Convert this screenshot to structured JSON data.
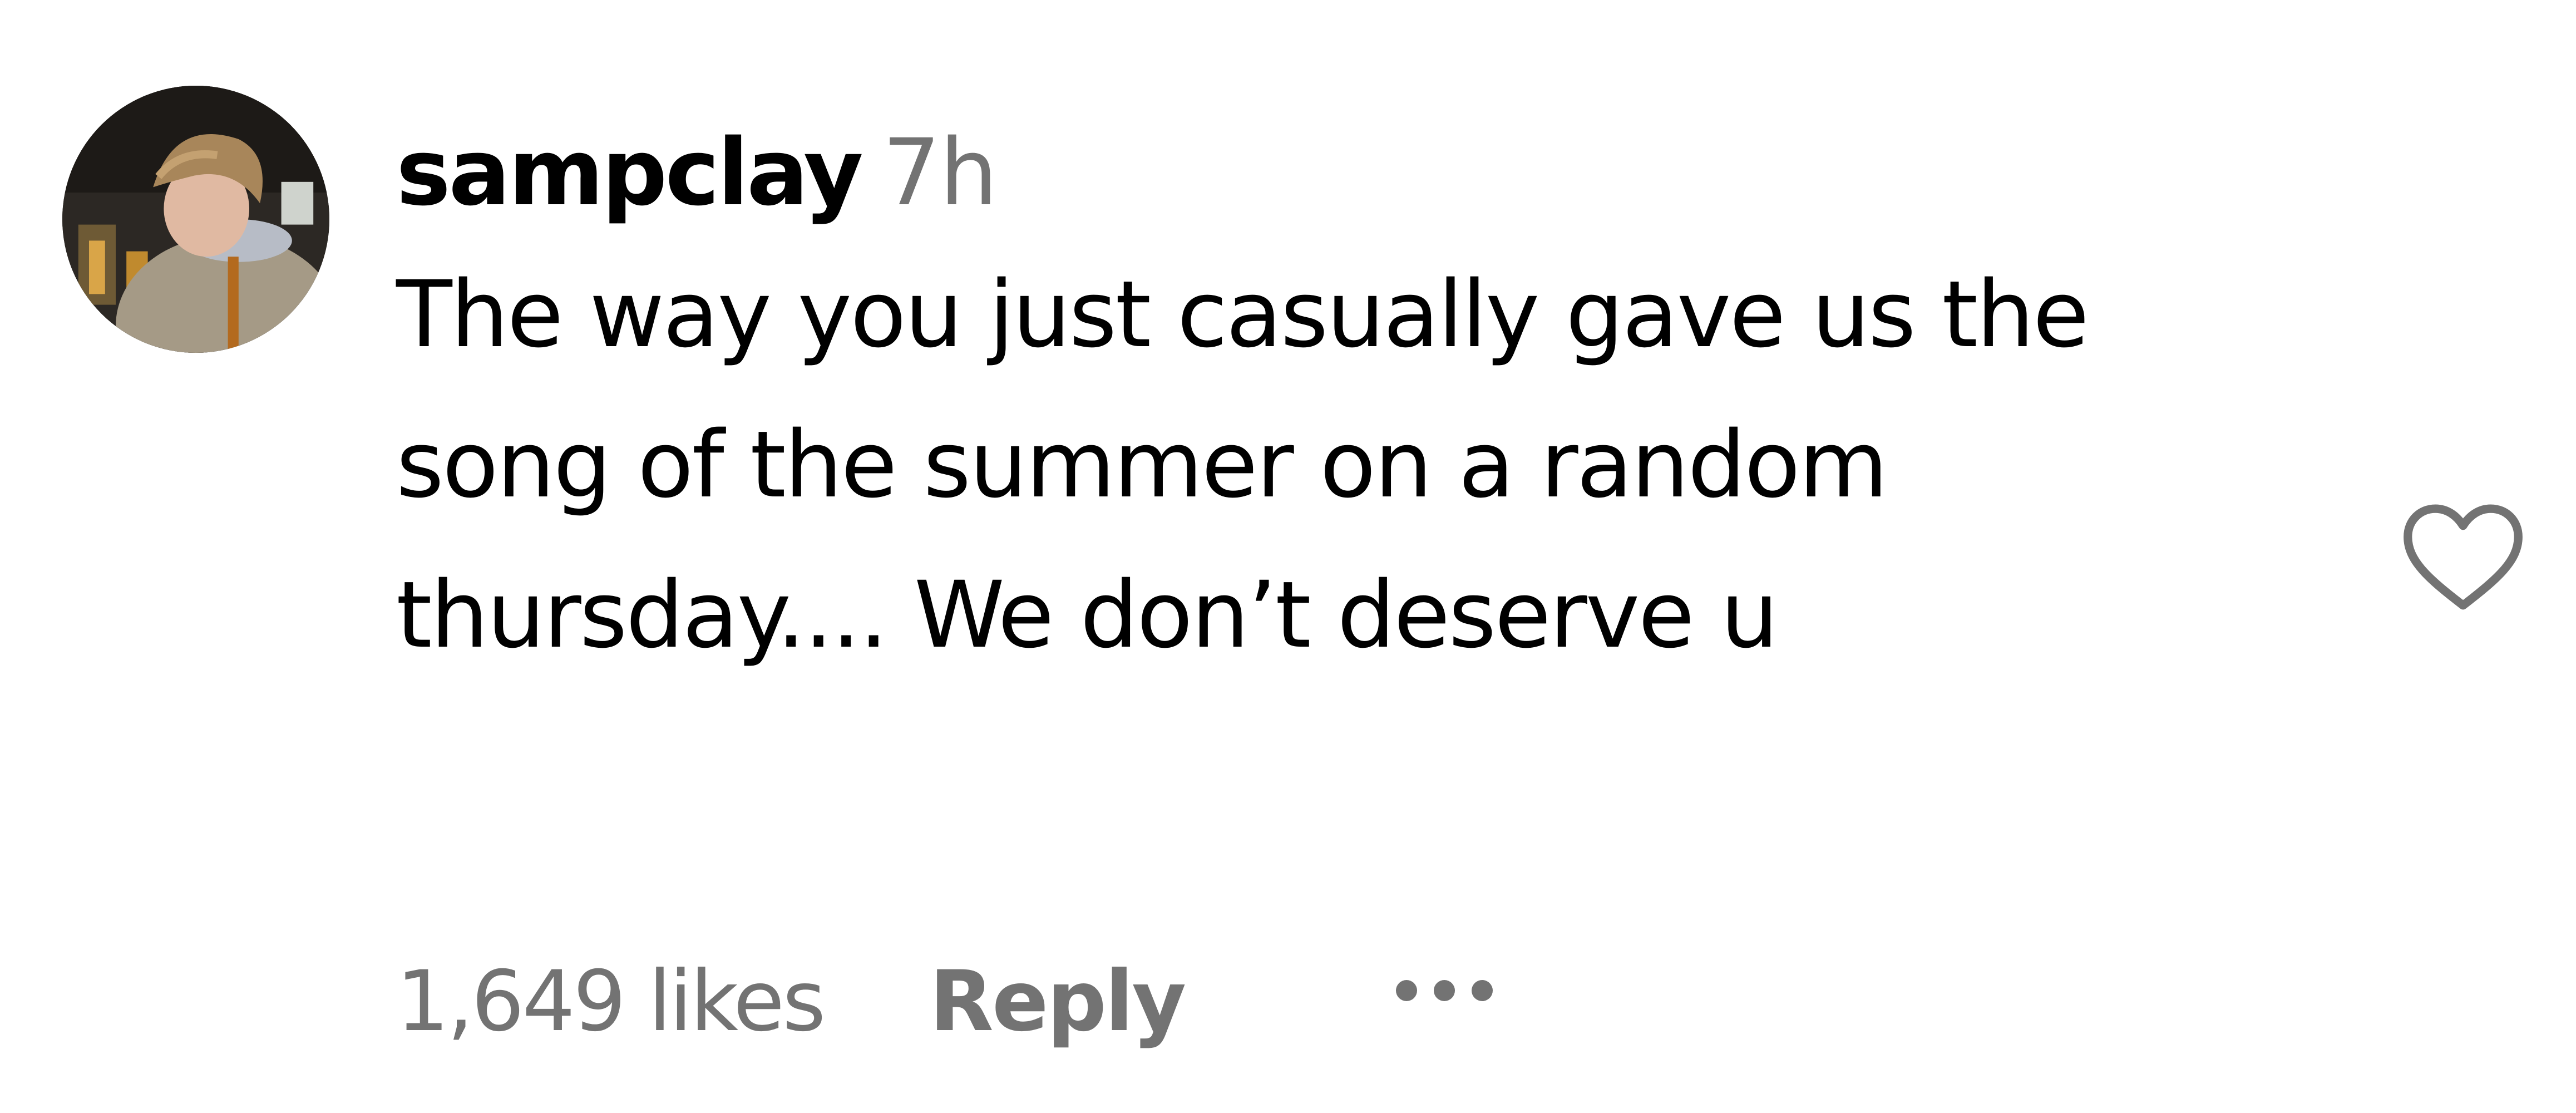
{
  "comment": {
    "username": "sampclay",
    "timestamp": "7h",
    "text": "The way you just casually gave us the song of the summer on a random thursday.... We don’t deserve u",
    "likes_label": "1,649 likes",
    "reply_label": "Reply",
    "like_icon": "heart-outline-icon",
    "more_icon": "more-options-icon"
  },
  "colors": {
    "text": "#000000",
    "secondary": "#737373",
    "background": "#ffffff"
  }
}
